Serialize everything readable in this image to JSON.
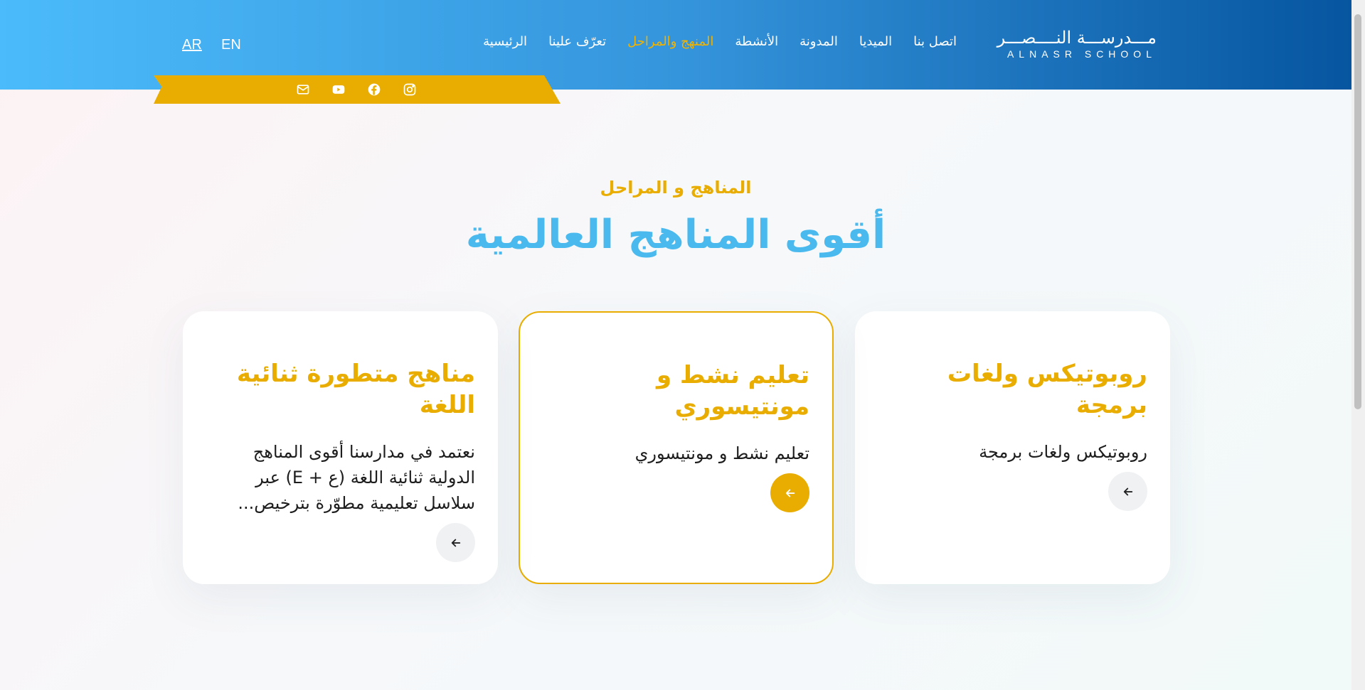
{
  "header": {
    "lang_ar": "AR",
    "lang_en": "EN",
    "logo_ar": "مـــدرســـة النــــصـــر",
    "logo_en": "ALNASR SCHOOL",
    "nav": [
      {
        "label": "الرئيسية"
      },
      {
        "label": "تعرّف علينا"
      },
      {
        "label": "المنهج والمراحل"
      },
      {
        "label": "الأنشطة"
      },
      {
        "label": "المدونة"
      },
      {
        "label": "الميديا"
      },
      {
        "label": "اتصل بنا"
      }
    ],
    "active_index": 2,
    "socials": [
      "email-icon",
      "youtube-icon",
      "facebook-icon",
      "instagram-icon"
    ]
  },
  "section": {
    "eyebrow": "المناهج و المراحل",
    "headline": "أقوى المناهج العالمية"
  },
  "cards": [
    {
      "title": "روبوتيكس ولغات برمجة",
      "text": "روبوتيكس ولغات برمجة"
    },
    {
      "title": "تعليم نشط و مونتيسوري",
      "text": "تعليم نشط و مونتيسوري"
    },
    {
      "title": "مناهج متطورة ثنائية اللغة",
      "text": "نعتمد في مدارسنا أقوى المناهج الدولية ثنائية اللغة (ع + E) عبر سلاسل تعليمية مطوّرة بترخيص..."
    }
  ],
  "colors": {
    "accent": "#e8ad00",
    "headline": "#49b9ee",
    "header_start": "#4bbbfb",
    "header_end": "#0655a0"
  }
}
